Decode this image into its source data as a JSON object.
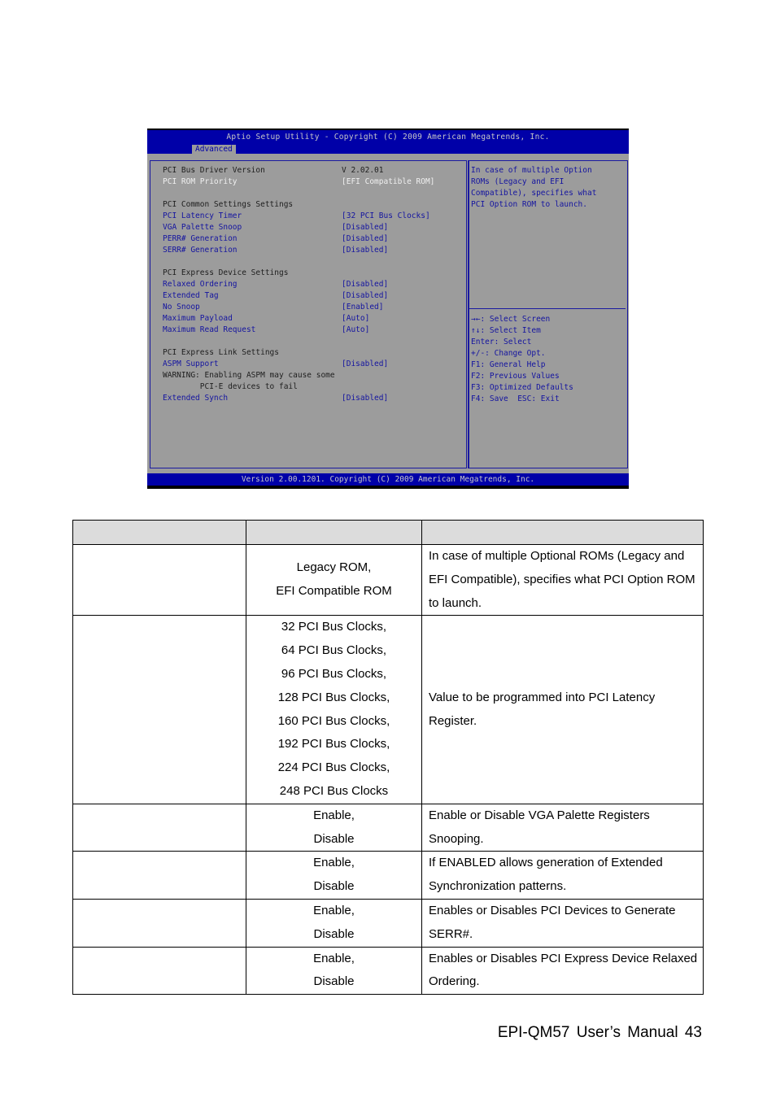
{
  "bios": {
    "title": "Aptio Setup Utility - Copyright (C) 2009 American Megatrends, Inc.",
    "active_tab": "Advanced",
    "footer": "Version 2.00.1201. Copyright (C) 2009 American Megatrends, Inc.",
    "rows": [
      {
        "label": "PCI Bus Driver Version",
        "value": "V 2.02.01",
        "style": "dark"
      },
      {
        "label": "PCI ROM Priority",
        "value": "[EFI Compatible ROM]",
        "style": "selected"
      },
      {
        "label": "",
        "value": "",
        "style": "blank"
      },
      {
        "label": "PCI Common Settings Settings",
        "value": "",
        "style": "dark"
      },
      {
        "label": "PCI Latency Timer",
        "value": "[32 PCI Bus Clocks]",
        "style": "blue"
      },
      {
        "label": "VGA Palette Snoop",
        "value": "[Disabled]",
        "style": "blue"
      },
      {
        "label": "PERR# Generation",
        "value": "[Disabled]",
        "style": "blue"
      },
      {
        "label": "SERR# Generation",
        "value": "[Disabled]",
        "style": "blue"
      },
      {
        "label": "",
        "value": "",
        "style": "blank"
      },
      {
        "label": "PCI Express Device Settings",
        "value": "",
        "style": "dark"
      },
      {
        "label": "Relaxed Ordering",
        "value": "[Disabled]",
        "style": "blue"
      },
      {
        "label": "Extended Tag",
        "value": "[Disabled]",
        "style": "blue"
      },
      {
        "label": "No Snoop",
        "value": "[Enabled]",
        "style": "blue"
      },
      {
        "label": "Maximum Payload",
        "value": "[Auto]",
        "style": "blue"
      },
      {
        "label": "Maximum Read Request",
        "value": "[Auto]",
        "style": "blue"
      },
      {
        "label": "",
        "value": "",
        "style": "blank"
      },
      {
        "label": "PCI Express Link Settings",
        "value": "",
        "style": "dark"
      },
      {
        "label": "ASPM Support",
        "value": "[Disabled]",
        "style": "blue"
      },
      {
        "label": "WARNING: Enabling ASPM may cause some",
        "value": "",
        "style": "dark"
      },
      {
        "label": "        PCI-E devices to fail",
        "value": "",
        "style": "dark"
      },
      {
        "label": "Extended Synch",
        "value": "[Disabled]",
        "style": "blue"
      }
    ],
    "help_text": [
      "In case of multiple Option",
      "ROMs (Legacy and EFI",
      "Compatible), specifies what",
      "PCI Option ROM to launch."
    ],
    "key_help": [
      "→←: Select Screen",
      "↑↓: Select Item",
      "Enter: Select",
      "+/-: Change Opt.",
      "F1: General Help",
      "F2: Previous Values",
      "F3: Optimized Defaults",
      "F4: Save  ESC: Exit"
    ]
  },
  "table": {
    "header": [
      "",
      "",
      ""
    ],
    "rows": [
      {
        "item": "",
        "options": [
          "Legacy ROM,",
          "EFI Compatible ROM"
        ],
        "description": "In case of multiple Optional ROMs (Legacy and EFI Compatible), specifies what PCI Option ROM to launch."
      },
      {
        "item": "",
        "options": [
          "32 PCI Bus Clocks,",
          "64 PCI Bus Clocks,",
          "96 PCI Bus Clocks,",
          "128 PCI Bus Clocks,",
          "160 PCI Bus Clocks,",
          "192 PCI Bus Clocks,",
          "224 PCI Bus Clocks,",
          "248 PCI Bus Clocks"
        ],
        "description": "Value to be programmed into PCI Latency Register."
      },
      {
        "item": "",
        "options": [
          "Enable,",
          "Disable"
        ],
        "description": "Enable or Disable VGA Palette Registers Snooping."
      },
      {
        "item": "",
        "options": [
          "Enable,",
          "Disable"
        ],
        "description": "If ENABLED allows generation of Extended Synchronization patterns."
      },
      {
        "item": "",
        "options": [
          "Enable,",
          "Disable"
        ],
        "description": "Enables or Disables PCI Devices to Generate SERR#."
      },
      {
        "item": "",
        "options": [
          "Enable,",
          "Disable"
        ],
        "description": "Enables or Disables PCI Express Device Relaxed Ordering."
      }
    ]
  },
  "footer": {
    "text": "EPI-QM57  User’s  Manual 43"
  }
}
